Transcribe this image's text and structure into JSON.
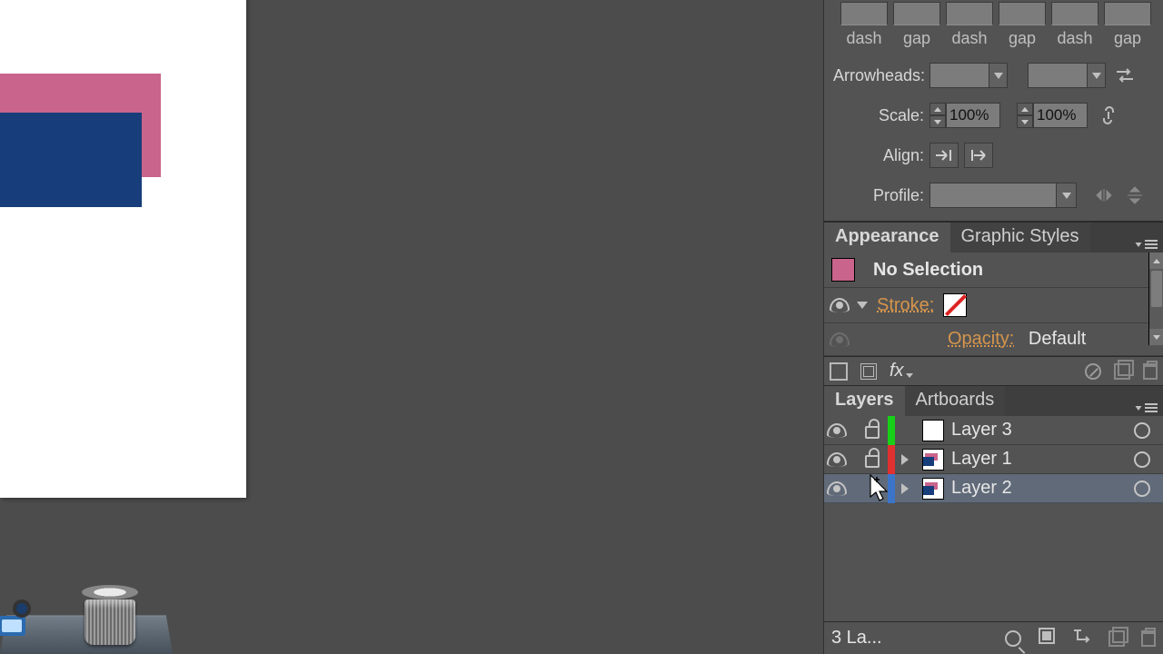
{
  "stroke_panel": {
    "dash_labels": [
      "dash",
      "gap",
      "dash",
      "gap",
      "dash",
      "gap"
    ],
    "arrowheads_label": "Arrowheads:",
    "scale_label": "Scale:",
    "scale_start": "100%",
    "scale_end": "100%",
    "align_label": "Align:",
    "profile_label": "Profile:"
  },
  "appearance": {
    "tab_appearance": "Appearance",
    "tab_graphic_styles": "Graphic Styles",
    "no_selection": "No Selection",
    "stroke_label": "Stroke:",
    "opacity_label": "Opacity:",
    "opacity_value": "Default",
    "swatch_color": "#c9648c",
    "fx_label": "fx"
  },
  "layers": {
    "tab_layers": "Layers",
    "tab_artboards": "Artboards",
    "rows": [
      {
        "name": "Layer 3",
        "color": "green",
        "locked": true,
        "expandable": false,
        "thumb": "blank",
        "selected": false
      },
      {
        "name": "Layer 1",
        "color": "red",
        "locked": true,
        "expandable": true,
        "thumb": "art",
        "selected": false
      },
      {
        "name": "Layer 2",
        "color": "blue",
        "locked": false,
        "expandable": true,
        "thumb": "art",
        "selected": true
      }
    ],
    "status": "3 La..."
  }
}
